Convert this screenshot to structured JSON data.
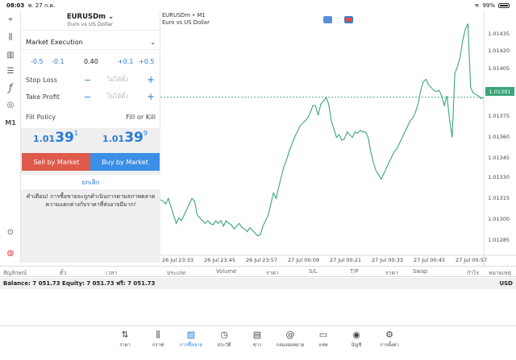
{
  "status": {
    "time": "08:03",
    "date": "พ. 27 ก.ค.",
    "battery": "99%"
  },
  "tools": [
    {
      "icon": "crosshair-icon",
      "glyph": "⌖"
    },
    {
      "icon": "candles-icon",
      "glyph": "⫼"
    },
    {
      "icon": "bars-icon",
      "glyph": "▥"
    },
    {
      "icon": "sliders-icon",
      "glyph": "☰"
    },
    {
      "icon": "function-icon",
      "glyph": "ƒ"
    },
    {
      "icon": "shapes-icon",
      "glyph": "◎"
    },
    {
      "icon": "timeframe-label",
      "glyph": "M1"
    },
    {
      "icon": "zoom-icon",
      "glyph": "⊙"
    },
    {
      "icon": "broker-logo-icon",
      "glyph": "◍"
    }
  ],
  "order": {
    "symbol": "EURUSDm",
    "description": "Euro vs US Dollar",
    "execution": "Market Execution",
    "volume_steps": [
      "-0.5",
      "-0.1",
      "+0.1",
      "+0.5"
    ],
    "volume": "0.40",
    "stop_loss": "Stop Loss",
    "take_profit": "Take Profit",
    "not_set": "ไม่ได้ตั้ง",
    "fill_policy": "Fill Policy",
    "fill_value": "Fill or Kill",
    "bid": {
      "small": "1.01",
      "big": "39",
      "sup": "1"
    },
    "ask": {
      "small": "1.01",
      "big": "39",
      "sup": "9"
    },
    "sell_label": "Sell by Market",
    "buy_label": "Buy by Market",
    "cancel_label": "ยกเลิก",
    "warning": "คำเตือน! การซื้อขายจะถูกดำเนินการตามสภาพตลาด ความแตกต่างกับราคาที่ส่งอาจมีมาก!"
  },
  "chart_header": {
    "title": "EURUSDm • M1",
    "subtitle": "Euro vs US Dollar"
  },
  "chart_data": {
    "type": "line",
    "series": [
      {
        "values": [
          1.01317,
          1.01316,
          1.01314,
          1.01318,
          1.01312,
          1.01306,
          1.013,
          1.01304,
          1.01302,
          1.01306,
          1.0131,
          1.01314,
          1.01318,
          1.01316,
          1.01306,
          1.01304,
          1.01302,
          1.013,
          1.01302,
          1.013,
          1.01299,
          1.01302,
          1.013,
          1.01302,
          1.01298,
          1.01302,
          1.013,
          1.01299,
          1.01296,
          1.01298,
          1.013,
          1.01297,
          1.01296,
          1.01294,
          1.01297,
          1.01295,
          1.01293,
          1.01291,
          1.01292,
          1.01298,
          1.01302,
          1.01306,
          1.01314,
          1.01322,
          1.01318,
          1.01326,
          1.01334,
          1.01341,
          1.01346,
          1.01352,
          1.01357,
          1.01362,
          1.01366,
          1.0137,
          1.01372,
          1.01374,
          1.01376,
          1.0138,
          1.01385,
          1.01385,
          1.01378,
          1.01386,
          1.01388,
          1.01391,
          1.01386,
          1.01374,
          1.01368,
          1.01362,
          1.01364,
          1.0136,
          1.01361,
          1.01366,
          1.01364,
          1.01362,
          1.01366,
          1.01365,
          1.01367,
          1.01366,
          1.01366,
          1.01362,
          1.01352,
          1.01344,
          1.01338,
          1.01335,
          1.01332,
          1.01336,
          1.0134,
          1.01344,
          1.01348,
          1.01352,
          1.01354,
          1.01358,
          1.01362,
          1.01366,
          1.0137,
          1.01374,
          1.01376,
          1.0138,
          1.01386,
          1.01396,
          1.01402,
          1.01404,
          1.014,
          1.01398,
          1.01396,
          1.01395,
          1.01396,
          1.01392,
          1.01385,
          1.01392,
          1.01375,
          1.01362,
          1.01408,
          1.01413,
          1.0142,
          1.01432,
          1.0144,
          1.01444,
          1.01398,
          1.01394,
          1.01393,
          1.01392,
          1.0139,
          1.01391
        ]
      }
    ],
    "x_tick_labels": [
      "26 Jul 23:33",
      "26 Jul 23:45",
      "26 Jul 23:57",
      "27 Jul 00:09",
      "27 Jul 00:21",
      "27 Jul 00:33",
      "27 Jul 00:45",
      "27 Jul 00:57"
    ],
    "y_tick_labels": [
      "1.01435",
      "1.01420",
      "1.01405",
      "1.01391",
      "1.01375",
      "1.01360",
      "1.01345",
      "1.01330",
      "1.01315",
      "1.01300",
      "1.01285"
    ],
    "ylim": [
      1.01277,
      1.01446
    ],
    "current_price": "1.01391",
    "line_color": "#3aa57a"
  },
  "table_headers": [
    "สัญลักษณ์",
    "ตั๋ว",
    "เวลา",
    "ประเภท",
    "Volume",
    "ราคา",
    "S/L",
    "T/P",
    "ราคา",
    "Swap",
    "กำไร",
    "หมายเหตุ"
  ],
  "account": {
    "text": "Balance: 7 051.73 Equity: 7 051.73 ฟรี: 7 051.73",
    "currency": "USD"
  },
  "tabs": [
    {
      "label": "ราคา",
      "icon": "quotes-icon",
      "glyph": "⇅"
    },
    {
      "label": "กราฟ",
      "icon": "chart-icon",
      "glyph": "⫼"
    },
    {
      "label": "การซื้อขาย",
      "icon": "trade-icon",
      "glyph": "▨"
    },
    {
      "label": "ประวัติ",
      "icon": "history-icon",
      "glyph": "◷"
    },
    {
      "label": "ข่าว",
      "icon": "news-icon",
      "glyph": "▤"
    },
    {
      "label": "กล่องจดหมาย",
      "icon": "mailbox-icon",
      "glyph": "@"
    },
    {
      "label": "แชท",
      "icon": "chat-icon",
      "glyph": "▭"
    },
    {
      "label": "บัญชี",
      "icon": "account-icon",
      "glyph": "◉"
    },
    {
      "label": "การตั้งค่า",
      "icon": "settings-icon",
      "glyph": "⚙"
    }
  ]
}
